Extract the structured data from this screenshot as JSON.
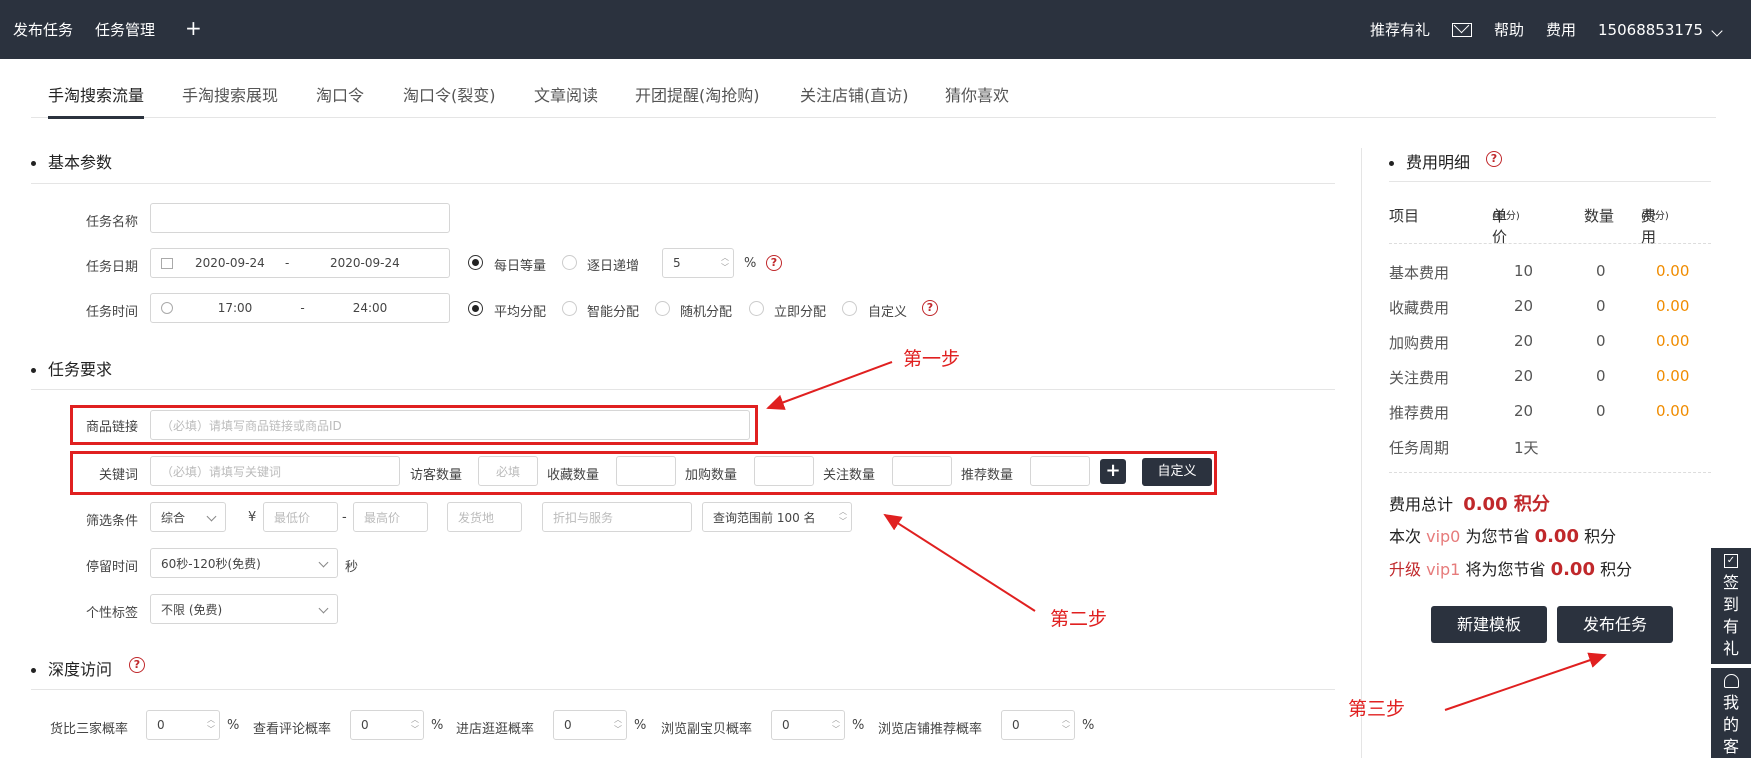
{
  "topbar": {
    "nav": [
      "发布任务",
      "任务管理"
    ],
    "right": {
      "recommend": "推荐有礼",
      "help": "帮助",
      "fee": "费用",
      "phone": "15068853175"
    }
  },
  "tabs": [
    "手淘搜索流量",
    "手淘搜索展现",
    "淘口令",
    "淘口令(裂变)",
    "文章阅读",
    "开团提醒(淘抢购)",
    "关注店铺(直访)",
    "猜你喜欢"
  ],
  "basic": {
    "title": "基本参数",
    "task_name_label": "任务名称",
    "task_date_label": "任务日期",
    "date_start": "2020-09-24",
    "date_end": "2020-09-24",
    "date_sep": "-",
    "daily_equal": "每日等量",
    "daily_increase": "逐日递增",
    "increase_value": "5",
    "percent": "%",
    "task_time_label": "任务时间",
    "time_start": "17:00",
    "time_end": "24:00",
    "dist_options": [
      "平均分配",
      "智能分配",
      "随机分配",
      "立即分配",
      "自定义"
    ]
  },
  "requirements": {
    "title": "任务要求",
    "product_link_label": "商品链接",
    "product_link_placeholder": "（必填）请填写商品链接或商品ID",
    "keyword_label": "关键词",
    "keyword_placeholder": "（必填）请填写关键词",
    "visitor_label": "访客数量",
    "visitor_placeholder": "必填",
    "fav_label": "收藏数量",
    "cart_label": "加购数量",
    "follow_label": "关注数量",
    "recommend_label": "推荐数量",
    "add_btn": "+",
    "custom_btn": "自定义",
    "filter_label": "筛选条件",
    "sort_value": "综合",
    "yen": "¥",
    "min_price": "最低价",
    "range_sep": "-",
    "max_price": "最高价",
    "ship_from": "发货地",
    "discount": "折扣与服务",
    "query_range": "查询范围前 100 名",
    "stay_label": "停留时间",
    "stay_value": "60秒-120秒(免费)",
    "stay_unit": "秒",
    "tag_label": "个性标签",
    "tag_value": "不限 (免费)"
  },
  "deep": {
    "title": "深度访问",
    "items": [
      {
        "label": "货比三家概率",
        "value": "0"
      },
      {
        "label": "查看评论概率",
        "value": "0"
      },
      {
        "label": "进店逛逛概率",
        "value": "0"
      },
      {
        "label": "浏览副宝贝概率",
        "value": "0"
      },
      {
        "label": "浏览店铺推荐概率",
        "value": "0"
      }
    ],
    "percent": "%"
  },
  "fees": {
    "title": "费用明细",
    "headers": {
      "item": "项目",
      "price": "单价",
      "price_unit": "(积分)",
      "qty": "数量",
      "cost": "费用",
      "cost_unit": "(积分)"
    },
    "rows": [
      {
        "name": "基本费用",
        "price": "10",
        "qty": "0",
        "cost": "0.00"
      },
      {
        "name": "收藏费用",
        "price": "20",
        "qty": "0",
        "cost": "0.00"
      },
      {
        "name": "加购费用",
        "price": "20",
        "qty": "0",
        "cost": "0.00"
      },
      {
        "name": "关注费用",
        "price": "20",
        "qty": "0",
        "cost": "0.00"
      },
      {
        "name": "推荐费用",
        "price": "20",
        "qty": "0",
        "cost": "0.00"
      }
    ],
    "period_label": "任务周期",
    "period_value": "1天",
    "total_label": "费用总计",
    "total_value": "0.00 积分",
    "save_prefix": "本次",
    "vip0": "vip0",
    "save_mid": "为您节省",
    "save_value": "0.00",
    "points": "积分",
    "upgrade": "升级",
    "vip1": "vip1",
    "save_mid2": "将为您节省",
    "save_value2": "0.00",
    "new_template": "新建模板",
    "publish": "发布任务"
  },
  "float": {
    "checkin": "签到有礼",
    "service": "我的客"
  },
  "annotations": {
    "step1": "第一步",
    "step2": "第二步",
    "step3": "第三步"
  },
  "colors": {
    "dark": "#2b323e",
    "accent_red": "#e02020",
    "orange": "#f08c00",
    "price_red": "#c0282b"
  }
}
